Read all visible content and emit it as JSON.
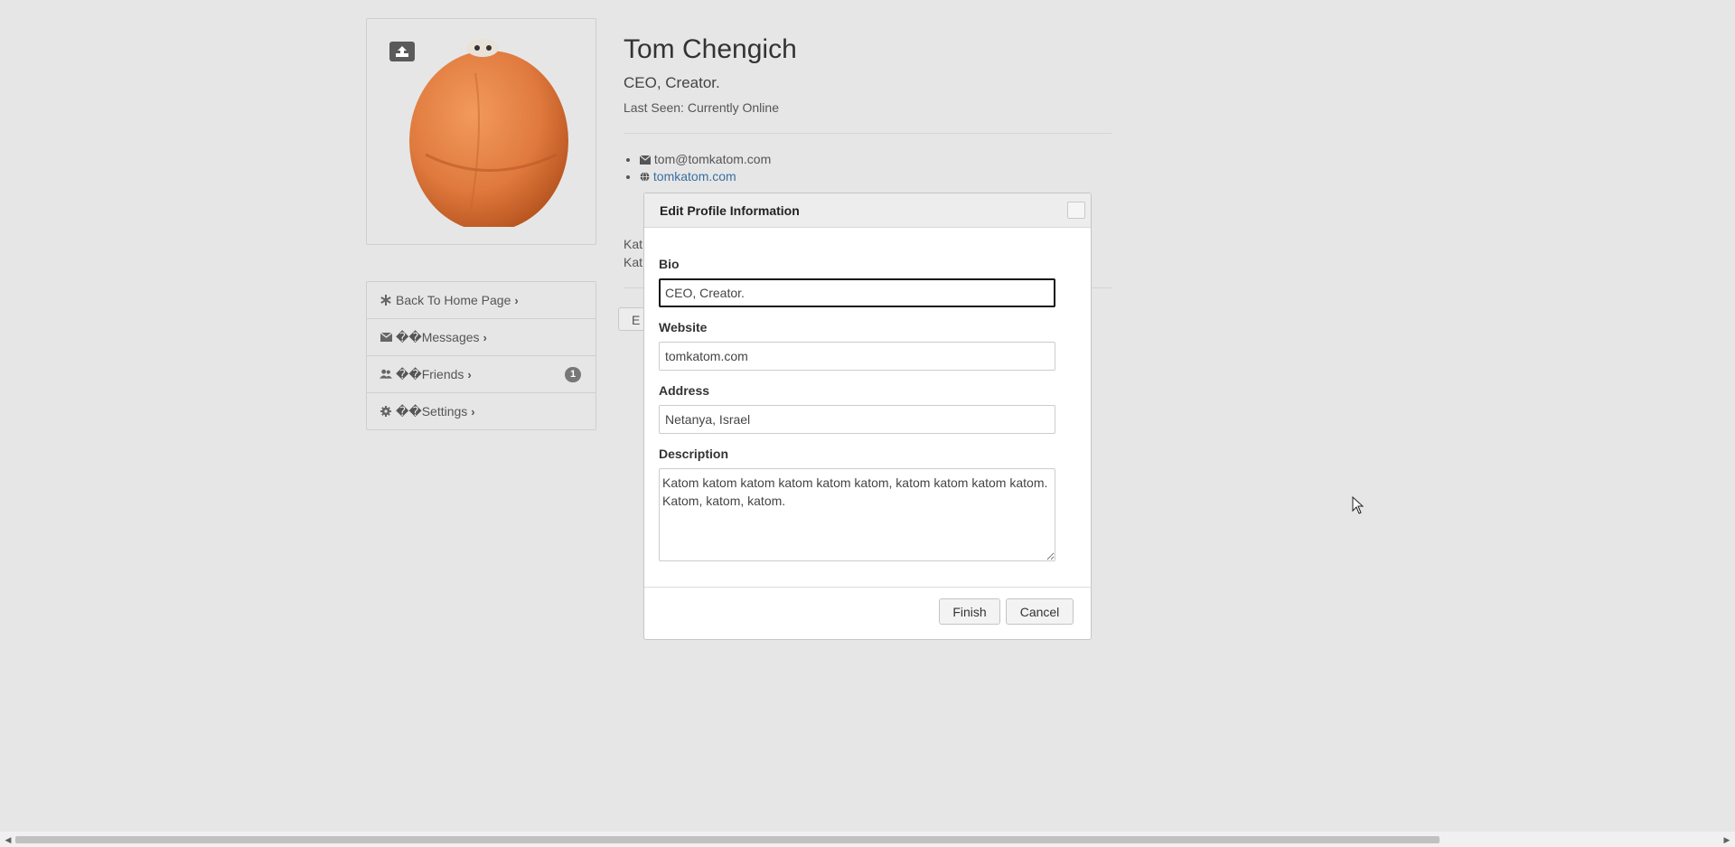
{
  "profile": {
    "name": "Tom Chengich",
    "bio": "CEO, Creator.",
    "last_seen": "Last Seen: Currently Online",
    "email": "tom@tomkatom.com",
    "website": "tomkatom.com",
    "description_line1": "Kat",
    "description_line2": "Kat",
    "edit_button_label": "E"
  },
  "sidebar": {
    "items": [
      {
        "label": "Back To Home Page",
        "icon": "asterisk-icon"
      },
      {
        "label": "��Messages",
        "icon": "envelope-icon"
      },
      {
        "label": "��Friends",
        "icon": "users-icon",
        "badge": "1"
      },
      {
        "label": "��Settings",
        "icon": "gear-icon"
      }
    ]
  },
  "modal": {
    "title": "Edit Profile Information",
    "fields": {
      "bio": {
        "label": "Bio",
        "value": "CEO, Creator."
      },
      "website": {
        "label": "Website",
        "value": "tomkatom.com"
      },
      "address": {
        "label": "Address",
        "value": "Netanya, Israel"
      },
      "description": {
        "label": "Description",
        "value": "Katom katom katom katom katom katom, katom katom katom katom. Katom, katom, katom."
      }
    },
    "finish_label": "Finish",
    "cancel_label": "Cancel"
  },
  "colors": {
    "background": "#e6e6e6",
    "link": "#3a6fa0",
    "avatar": "#e07a3e"
  }
}
